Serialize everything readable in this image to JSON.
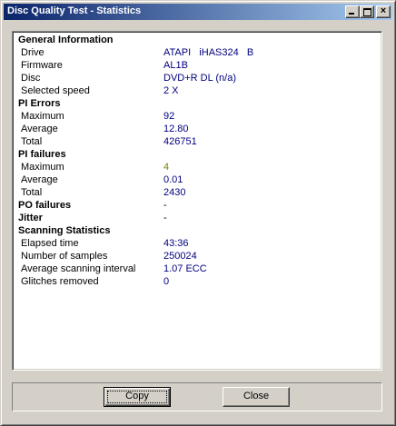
{
  "window": {
    "title": "Disc Quality Test - Statistics",
    "controls": {
      "minimize": "minimize-icon",
      "maximize": "maximize-icon",
      "close": "close-icon",
      "close_glyph": "×"
    }
  },
  "stats": {
    "general": {
      "heading": "General Information",
      "rows": [
        {
          "label": "Drive",
          "value": "ATAPI   iHAS324   B"
        },
        {
          "label": "Firmware",
          "value": "AL1B"
        },
        {
          "label": "Disc",
          "value": "DVD+R DL (n/a)"
        },
        {
          "label": "Selected speed",
          "value": "2 X"
        }
      ]
    },
    "pi_errors": {
      "heading": "PI Errors",
      "rows": [
        {
          "label": "Maximum",
          "value": "92"
        },
        {
          "label": "Average",
          "value": "12.80"
        },
        {
          "label": "Total",
          "value": "426751"
        }
      ]
    },
    "pi_failures": {
      "heading": "PI failures",
      "rows": [
        {
          "label": "Maximum",
          "value": "4"
        },
        {
          "label": "Average",
          "value": "0.01"
        },
        {
          "label": "Total",
          "value": "2430"
        }
      ]
    },
    "po_failures": {
      "heading": "PO failures",
      "value": "-"
    },
    "jitter": {
      "heading": "Jitter",
      "value": "-"
    },
    "scanning": {
      "heading": "Scanning Statistics",
      "rows": [
        {
          "label": "Elapsed time",
          "value": "43:36"
        },
        {
          "label": "Number of samples",
          "value": "250024"
        },
        {
          "label": "Average scanning interval",
          "value": "1.07 ECC"
        },
        {
          "label": "Glitches removed",
          "value": "0"
        }
      ]
    }
  },
  "colors": {
    "value_text": "#00007f",
    "warning_value": "#7f7f00",
    "titlebar_start": "#0a246a",
    "titlebar_end": "#a6caf0"
  },
  "buttons": {
    "copy_label": "Copy",
    "close_label": "Close"
  }
}
